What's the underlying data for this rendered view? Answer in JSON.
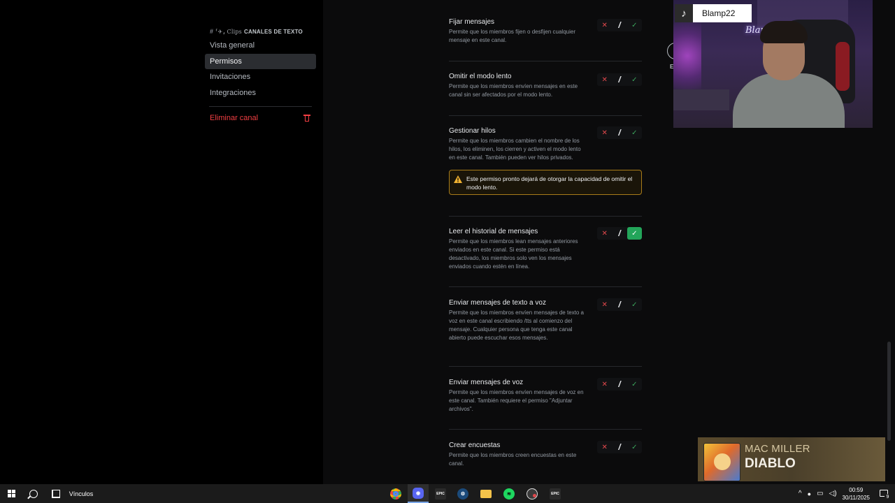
{
  "sidebar": {
    "header": {
      "hash_glyph": "#",
      "decorative_text": "⸢✈︎⸥ Clips",
      "category_label": "CANALES DE TEXTO"
    },
    "items": [
      {
        "label": "Vista general",
        "active": false
      },
      {
        "label": "Permisos",
        "active": true
      },
      {
        "label": "Invitaciones",
        "active": false
      },
      {
        "label": "Integraciones",
        "active": false
      }
    ],
    "danger_label": "Eliminar canal"
  },
  "main": {
    "close_label": "E",
    "permissions": [
      {
        "title": "Fijar mensajes",
        "description": "Permite que los miembros fijen o desfijen cualquier mensaje en este canal.",
        "state": "neutral"
      },
      {
        "title": "Omitir el modo lento",
        "description": "Permite que los miembros envíen mensajes en este canal sin ser afectados por el modo lento.",
        "state": "neutral"
      },
      {
        "title": "Gestionar hilos",
        "description": "Permite que los miembros cambien el nombre de los hilos, los eliminen, los cierren y activen el modo lento en este canal. También pueden ver hilos privados.",
        "state": "neutral",
        "warning": "Este permiso pronto dejará de otorgar la capacidad de omitir el modo lento."
      },
      {
        "title": "Leer el historial de mensajes",
        "description": "Permite que los miembros lean mensajes anteriores enviados en este canal. Si este permiso está desactivado, los miembros solo ven los mensajes enviados cuando estén en línea.",
        "state": "allow"
      },
      {
        "title": "Enviar mensajes de texto a voz",
        "description": "Permite que los miembros envíen mensajes de texto a voz en este canal escribiendo /tts al comienzo del mensaje. Cualquier persona que tenga este canal abierto puede escuchar esos mensajes.",
        "state": "neutral"
      },
      {
        "title": "Enviar mensajes de voz",
        "description": "Permite que los miembros envíen mensajes de voz en este canal. También requiere el permiso \"Adjuntar archivos\".",
        "state": "neutral"
      },
      {
        "title": "Crear encuestas",
        "description": "Permite que los miembros creen encuestas en este canal.",
        "state": "neutral"
      }
    ],
    "toggle_glyphs": {
      "deny": "✕",
      "pass": "/",
      "allow": "✓"
    }
  },
  "overlay": {
    "tiktok_username": "Blamp22",
    "tiktok_logo_glyph": "♪",
    "webcam_neon_text": "Blam",
    "now_playing": {
      "artist": "MAC MILLER",
      "song": "DIABLO"
    }
  },
  "taskbar": {
    "links_label": "Vínculos",
    "apps": [
      {
        "name": "chrome",
        "glyph": "",
        "color": "#e8453c",
        "active": false
      },
      {
        "name": "discord",
        "glyph": "",
        "color": "#5865f2",
        "active": true
      },
      {
        "name": "epic-games",
        "glyph": "EPIC",
        "color": "#2a2a2a",
        "active": false
      },
      {
        "name": "steam",
        "glyph": "",
        "color": "#1b4a7a",
        "active": false
      },
      {
        "name": "file-explorer",
        "glyph": "",
        "color": "#f2c24a",
        "active": false
      },
      {
        "name": "spotify",
        "glyph": "",
        "color": "#1ed760",
        "active": false
      },
      {
        "name": "obs-record",
        "glyph": "",
        "color": "#3a3a3a",
        "active": false
      },
      {
        "name": "epic-games-2",
        "glyph": "EPIC",
        "color": "#2a2a2a",
        "active": false
      }
    ],
    "tray": {
      "chevron": "^",
      "mic": "🎤",
      "network": "▭",
      "volume": "🔊"
    },
    "time": "00:59",
    "date": "30/11/2025",
    "notification_count": "9"
  },
  "colors": {
    "accent_allow": "#23a55a",
    "deny": "#e2484c",
    "danger": "#f23f43",
    "warning_border": "#a97c1a"
  }
}
